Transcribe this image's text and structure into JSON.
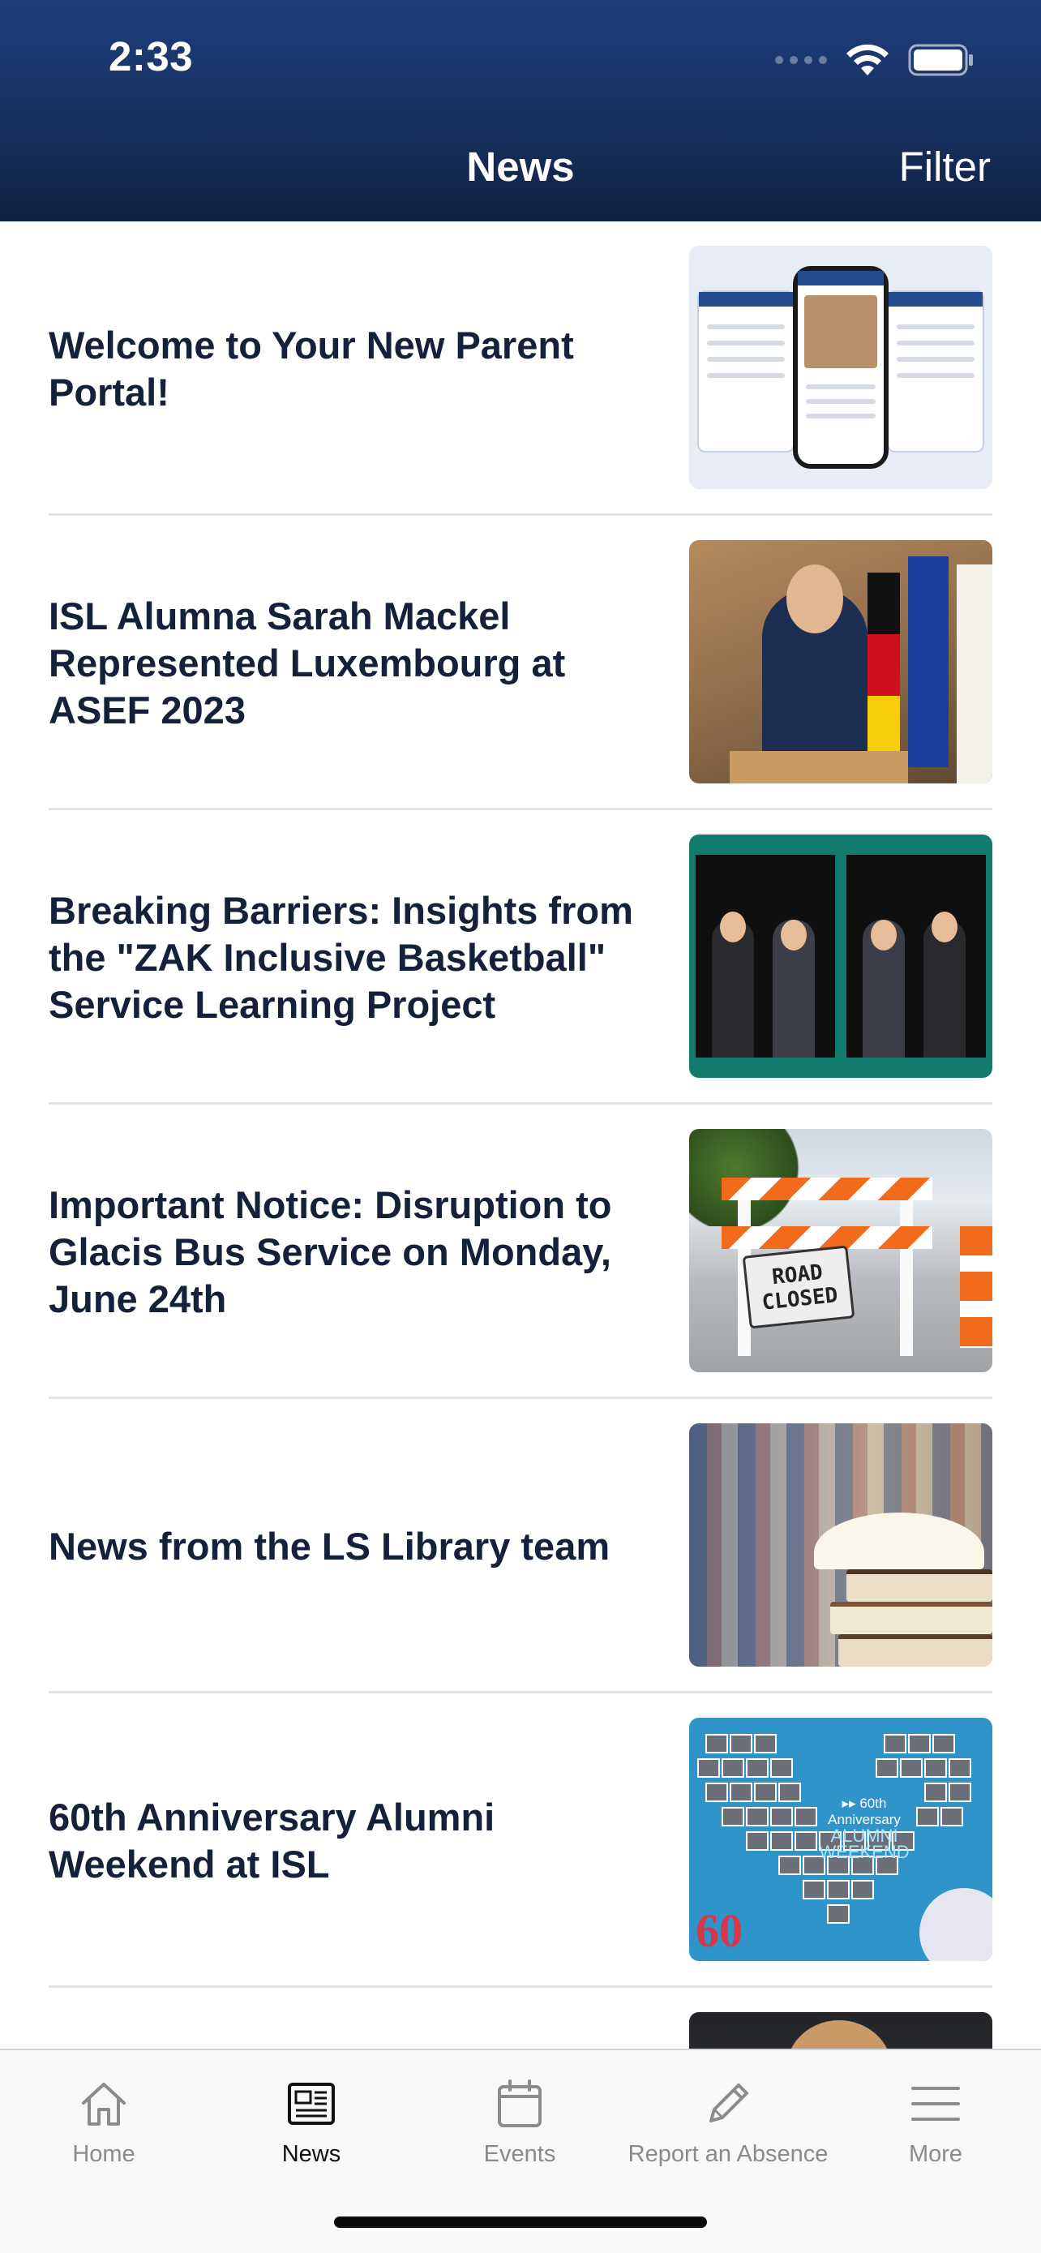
{
  "status_bar": {
    "time": "2:33"
  },
  "header": {
    "title": "News",
    "filter_label": "Filter"
  },
  "news_items": [
    {
      "title": "Welcome to Your New Parent Portal!",
      "thumbnail": "app-screenshots"
    },
    {
      "title": "ISL Alumna Sarah Mackel Represented Luxembourg at ASEF 2023",
      "thumbnail": "speaker-at-podium"
    },
    {
      "title": "Breaking Barriers: Insights from the \"ZAK Inclusive Basketball\" Service Learning Project",
      "thumbnail": "graduation-photos"
    },
    {
      "title": "Important Notice: Disruption to Glacis Bus Service on Monday, June 24th",
      "thumbnail": "road-closed-barrier",
      "sign_line1": "ROAD",
      "sign_line2": "CLOSED"
    },
    {
      "title": "News from the LS Library team",
      "thumbnail": "library-books"
    },
    {
      "title": "60th Anniversary Alumni Weekend at ISL",
      "thumbnail": "alumni-collage",
      "caption_line1": "▸▸ 60th Anniversary",
      "caption_line2": "ALUMNI",
      "caption_line3": "WEEKEND",
      "badge": "60"
    },
    {
      "title": "",
      "thumbnail": "portrait"
    }
  ],
  "tab_bar": {
    "tabs": [
      {
        "label": "Home",
        "icon": "home-icon",
        "active": false
      },
      {
        "label": "News",
        "icon": "newspaper-icon",
        "active": true
      },
      {
        "label": "Events",
        "icon": "calendar-icon",
        "active": false
      },
      {
        "label": "Report an Absence",
        "icon": "pencil-icon",
        "active": false
      },
      {
        "label": "More",
        "icon": "menu-icon",
        "active": false
      }
    ]
  },
  "colors": {
    "header_top": "#1f3e7c",
    "header_bottom": "#0f2244",
    "title_text": "#15213a",
    "tab_inactive": "#8a8a8f",
    "tab_active": "#111111"
  }
}
